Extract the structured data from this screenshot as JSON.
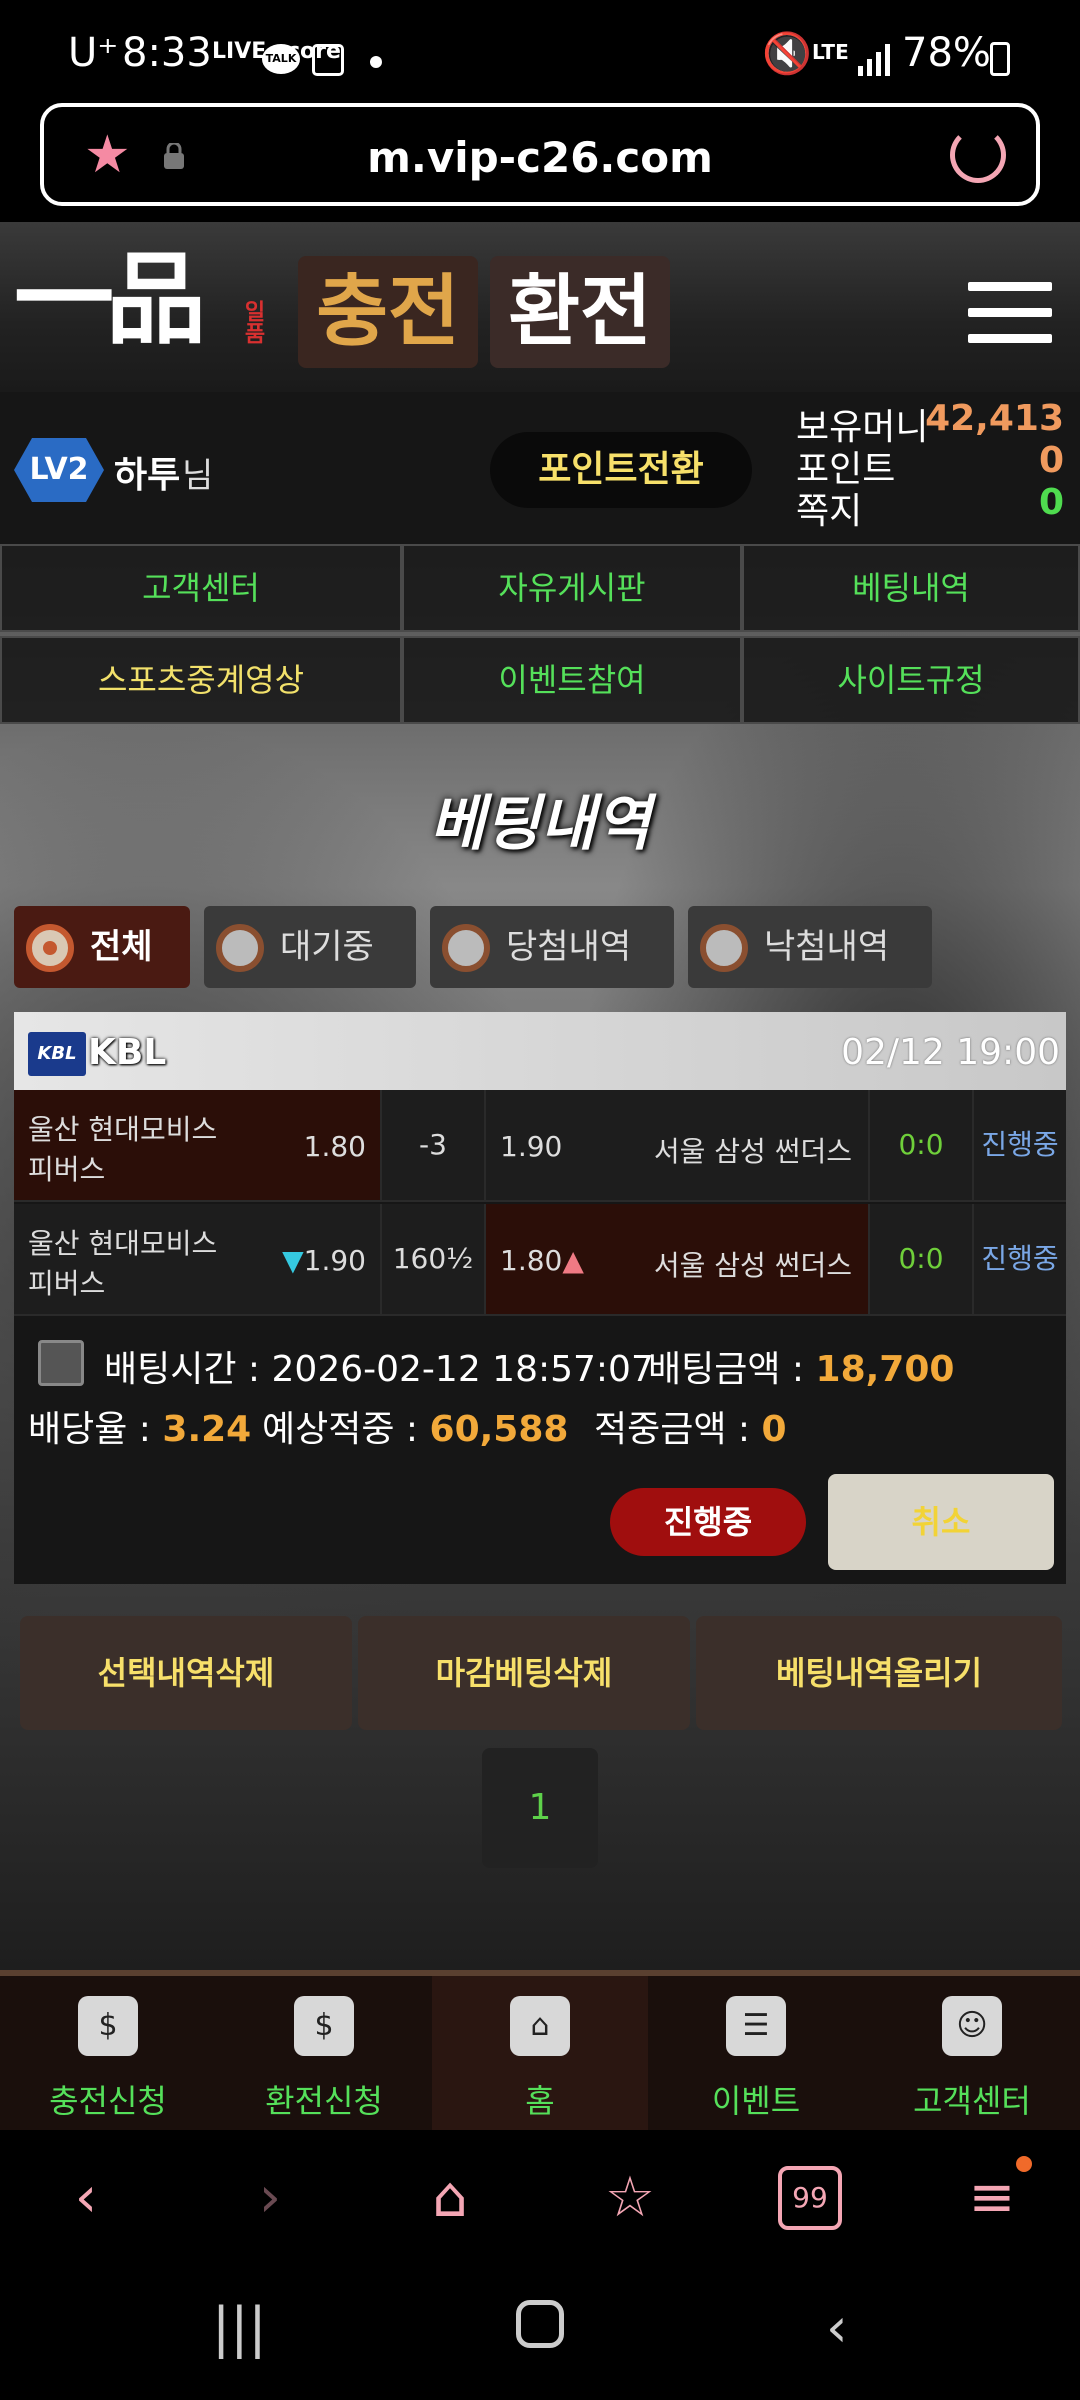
{
  "status_bar": {
    "carrier": "U⁺",
    "time": "8:33",
    "live_icon": "LIVE score",
    "talk_icon": "TALK",
    "network": "LTE",
    "battery": "78%"
  },
  "browser": {
    "url": "m.vip-c26.com",
    "icons": [
      "star-icon",
      "lock-icon",
      "reload-icon"
    ]
  },
  "site": {
    "logo": "一品",
    "logo_sub": "일품",
    "charge_button": "충전",
    "exchange_button": "환전"
  },
  "user": {
    "level": "LV2",
    "name": "하투",
    "suffix": "님",
    "point_convert_button": "포인트전환",
    "money_label": "보유머니",
    "money_value": "42,413",
    "point_label": "포인트",
    "point_value": "0",
    "message_label": "쪽지",
    "message_value": "0"
  },
  "menu": [
    "고객센터",
    "자유게시판",
    "베팅내역",
    "스포츠중계영상",
    "이벤트참여",
    "사이트규정"
  ],
  "page_title": "베팅내역",
  "filters": [
    "전체",
    "대기중",
    "당첨내역",
    "낙첨내역"
  ],
  "bet": {
    "league_logo": "KBL",
    "league": "KBL",
    "datetime": "02/12 19:00",
    "rows": [
      {
        "home_team": "울산 현대모비스 피버스",
        "home_odd": "1.80",
        "handicap": "-3",
        "away_odd": "1.90",
        "away_team": "서울 삼성 썬더스",
        "score": "0:0",
        "status": "진행중",
        "selected": "home"
      },
      {
        "home_team": "울산 현대모비스 피버스",
        "home_odd": "1.90",
        "home_arrow": "▼",
        "handicap": "160½",
        "away_odd": "1.80",
        "away_arrow": "▲",
        "away_team": "서울 삼성 썬더스",
        "score": "0:0",
        "status": "진행중",
        "selected": "away"
      }
    ],
    "bet_time_label": "배팅시간 :",
    "bet_time": "2026-02-12 18:57:07",
    "bet_amount_label": "배팅금액 :",
    "bet_amount": "18,700",
    "odds_label": "배당율 :",
    "odds": "3.24",
    "expected_label": "예상적중 :",
    "expected": "60,588",
    "won_label": "적중금액 :",
    "won": "0",
    "status_badge": "진행중",
    "cancel_button": "취소"
  },
  "actions": {
    "delete_selected": "선택내역삭제",
    "delete_closed": "마감베팅삭제",
    "upload_history": "베팅내역올리기"
  },
  "pagination": {
    "current": "1"
  },
  "site_nav": [
    {
      "label": "충전신청",
      "icon": "coins-icon"
    },
    {
      "label": "환전신청",
      "icon": "money-bag-icon"
    },
    {
      "label": "홈",
      "icon": "home-icon"
    },
    {
      "label": "이벤트",
      "icon": "chat-icon"
    },
    {
      "label": "고객센터",
      "icon": "support-icon"
    }
  ],
  "browser_nav": {
    "icons": [
      "back-icon",
      "forward-icon",
      "home-icon",
      "bookmarks-icon",
      "tabs-icon",
      "menu-icon"
    ],
    "tabs_count": "99"
  },
  "colors": {
    "accent_green": "#55e05a",
    "accent_yellow": "#f7e06a",
    "money_orange": "#f09a5e",
    "status_red": "#a00e0e"
  }
}
